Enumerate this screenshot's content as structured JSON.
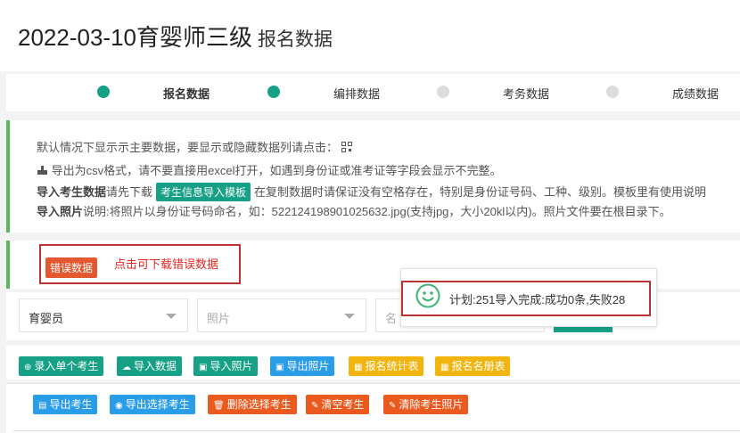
{
  "header": {
    "title_main": "2022-03-10育婴师三级",
    "title_sub": "报名数据"
  },
  "steps": [
    {
      "label": "报名数据",
      "status": "active"
    },
    {
      "label": "编排数据",
      "status": "active"
    },
    {
      "label": "考务数据",
      "status": "inactive"
    },
    {
      "label": "成绩数据",
      "status": "inactive"
    }
  ],
  "info": {
    "line1": "默认情况下显示示主要数据，要显示或隐藏数据列请点击：",
    "line2": "导出为csv格式，请不要直接用excel打开，如遇到身份证或准考证等字段会显示不完整。",
    "line3_bold": "导入考生数据",
    "line3_pre": "请先下载",
    "line3_tag": "考生信息导入模板",
    "line3_post": "在复制数据时请保证没有空格存在，特别是身份证号码、工种、级别。模板里有使用说明",
    "line4_bold": "导入照片",
    "line4_text": "说明:将照片以身份证号码命名，如：522124198901025632.jpg(支持jpg，大小20kl以内)。照片文件要在根目录下。"
  },
  "error": {
    "button_label": "错误数据",
    "text": "点击可下载错误数据"
  },
  "filters": {
    "type_value": "育婴员",
    "photo_placeholder": "照片",
    "name_placeholder": "名"
  },
  "toast": {
    "text": "计划:251导入完成:成功0条,失败28"
  },
  "toolbar1": [
    {
      "label": "录入单个考生",
      "icon": "⊕",
      "color": "green"
    },
    {
      "label": "导入数据",
      "icon": "☁",
      "color": "green"
    },
    {
      "label": "导入照片",
      "icon": "▣",
      "color": "green"
    },
    {
      "label": "导出照片",
      "icon": "▣",
      "color": "blue"
    },
    {
      "label": "报名统计表",
      "icon": "▦",
      "color": "yellow"
    },
    {
      "label": "报名名册表",
      "icon": "▦",
      "color": "yellow"
    }
  ],
  "toolbar2": [
    {
      "label": "导出考生",
      "icon": "▤",
      "color": "blue"
    },
    {
      "label": "导出选择考生",
      "icon": "◉",
      "color": "blue"
    },
    {
      "label": "删除选择考生",
      "icon": "🗑",
      "color": "orange"
    },
    {
      "label": "清空考生",
      "icon": "✎",
      "color": "orange"
    },
    {
      "label": "清除考生照片",
      "icon": "✎",
      "color": "orange"
    }
  ]
}
